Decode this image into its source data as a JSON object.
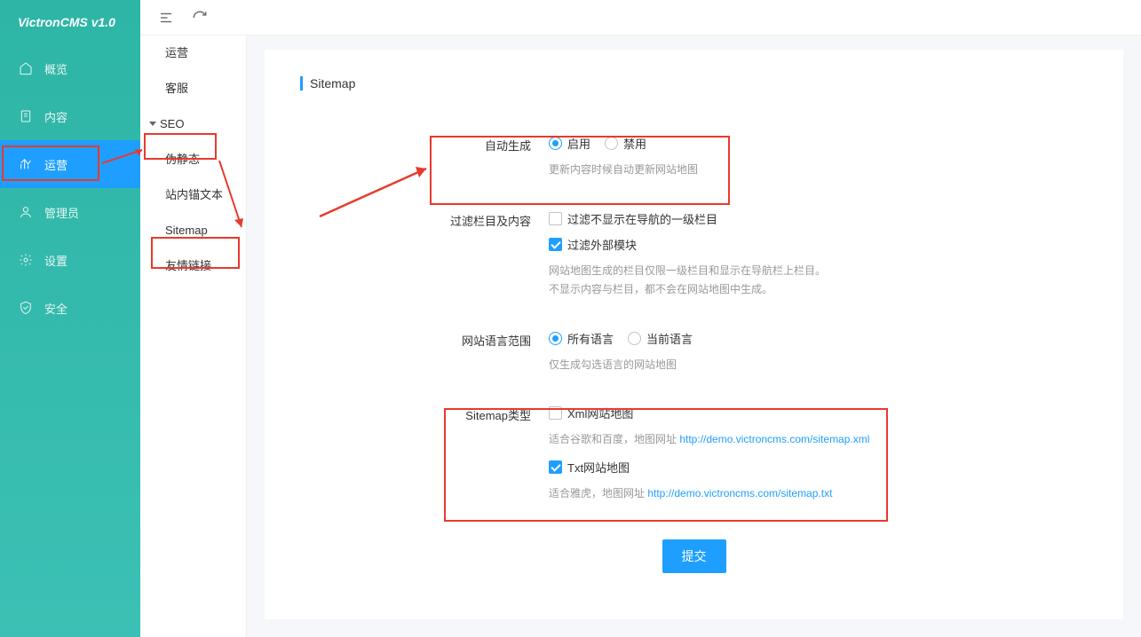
{
  "app": {
    "name": "VictronCMS v1.0"
  },
  "nav": {
    "items": [
      {
        "key": "overview",
        "label": "概览",
        "icon": "home"
      },
      {
        "key": "content",
        "label": "内容",
        "icon": "doc"
      },
      {
        "key": "operate",
        "label": "运营",
        "icon": "chart",
        "active": true
      },
      {
        "key": "admin",
        "label": "管理员",
        "icon": "user"
      },
      {
        "key": "settings",
        "label": "设置",
        "icon": "gear"
      },
      {
        "key": "security",
        "label": "安全",
        "icon": "shield"
      }
    ]
  },
  "subnav": {
    "items": [
      {
        "label": "运营"
      },
      {
        "label": "客服"
      },
      {
        "label": "SEO",
        "group": true
      },
      {
        "label": "伪静态",
        "child": true
      },
      {
        "label": "站内锚文本",
        "child": true
      },
      {
        "label": "Sitemap",
        "child": true,
        "active": true
      },
      {
        "label": "友情链接"
      }
    ]
  },
  "page": {
    "title": "Sitemap"
  },
  "form": {
    "autogen": {
      "label": "自动生成",
      "opt_enable": "启用",
      "opt_disable": "禁用",
      "hint": "更新内容时候自动更新网站地图"
    },
    "filter": {
      "label": "过滤栏目及内容",
      "opt_hidden": "过滤不显示在导航的一级栏目",
      "opt_external": "过滤外部模块",
      "hint1": "网站地图生成的栏目仅限一级栏目和显示在导航栏上栏目。",
      "hint2": "不显示内容与栏目，都不会在网站地图中生成。"
    },
    "lang": {
      "label": "网站语言范围",
      "opt_all": "所有语言",
      "opt_current": "当前语言",
      "hint": "仅生成勾选语言的网站地图"
    },
    "type": {
      "label": "Sitemap类型",
      "opt_xml": "Xml网站地图",
      "hint_xml_pre": "适合谷歌和百度，地图网址 ",
      "hint_xml_url": "http://demo.victroncms.com/sitemap.xml",
      "opt_txt": "Txt网站地图",
      "hint_txt_pre": "适合雅虎，地图网址 ",
      "hint_txt_url": "http://demo.victroncms.com/sitemap.txt"
    },
    "submit": "提交"
  }
}
